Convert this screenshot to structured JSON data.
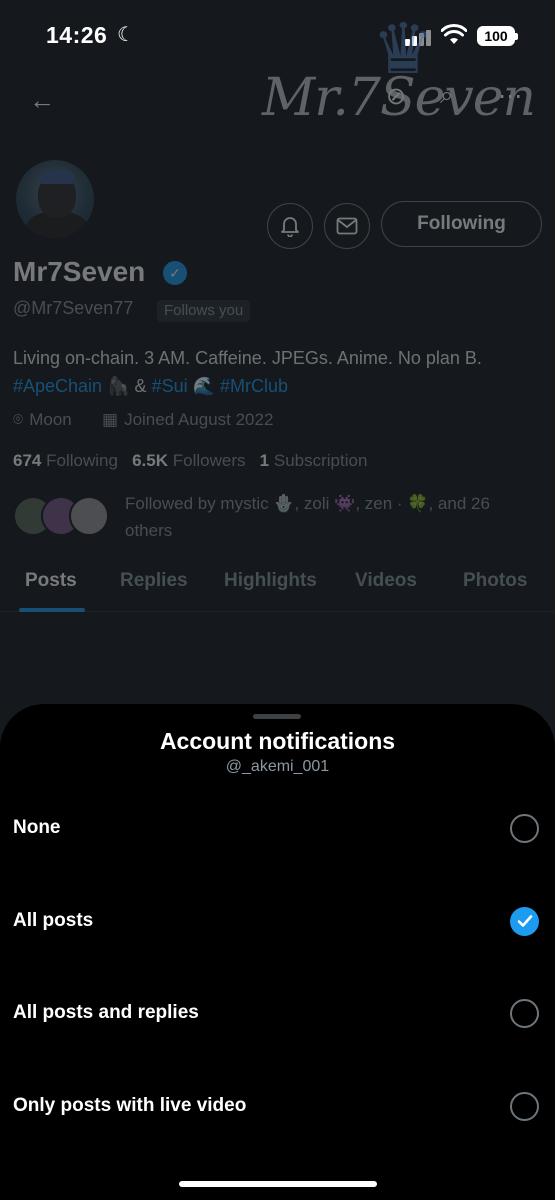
{
  "status_bar": {
    "time": "14:26",
    "battery": "100"
  },
  "profile": {
    "logo_text": "Mr.7Seven",
    "display_name": "Mr7Seven",
    "handle": "@Mr7Seven77",
    "follows_you": "Follows you",
    "following_button": "Following",
    "bio_text": "Living on-chain. 3 AM. Caffeine. JPEGs. Anime. No plan B.",
    "bio_tag_1": "#ApeChain",
    "bio_emoji_1": "🦍",
    "bio_amp": "&",
    "bio_tag_2": "#Sui",
    "bio_emoji_2": "🌊",
    "bio_tag_3": "#MrClub",
    "location": "Moon",
    "joined": "Joined August 2022",
    "following_count": "674",
    "following_label": "Following",
    "followers_count": "6.5K",
    "followers_label": "Followers",
    "subscription_count": "1",
    "subscription_label": "Subscription",
    "followed_by": "Followed by mystic 🪬, zoli 👾, zen · 🍀, and 26 others"
  },
  "tabs": [
    {
      "label": "Posts",
      "active": true
    },
    {
      "label": "Replies",
      "active": false
    },
    {
      "label": "Highlights",
      "active": false
    },
    {
      "label": "Videos",
      "active": false
    },
    {
      "label": "Photos",
      "active": false
    }
  ],
  "sheet": {
    "title": "Account notifications",
    "subtitle": "@_akemi_001",
    "options": [
      {
        "label": "None",
        "selected": false
      },
      {
        "label": "All posts",
        "selected": true
      },
      {
        "label": "All posts and replies",
        "selected": false
      },
      {
        "label": "Only posts with live video",
        "selected": false
      }
    ]
  },
  "colors": {
    "accent": "#1d9bf0",
    "sheet_background": "#000000",
    "page_background": "#15181c"
  }
}
